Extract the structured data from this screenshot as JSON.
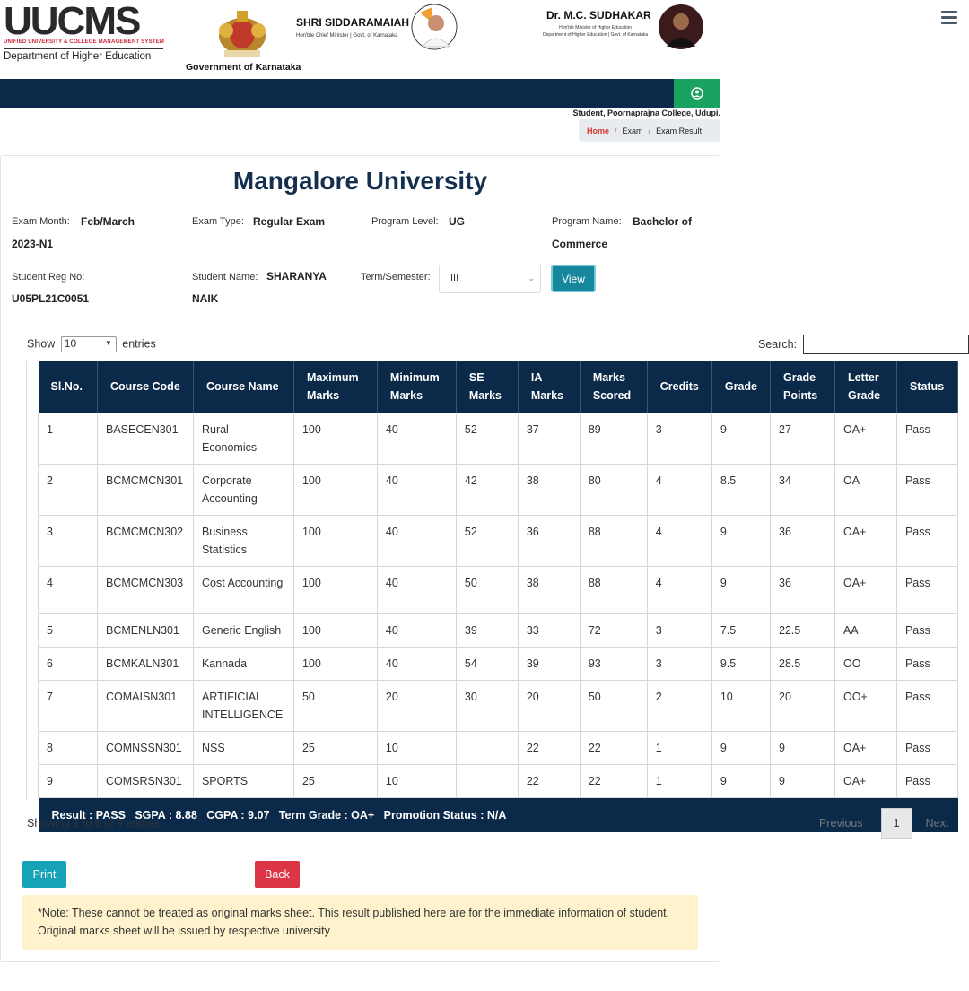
{
  "header": {
    "logo_text": "UUCMS",
    "logo_tagline": "UNIFIED UNIVERSITY & COLLEGE MANAGEMENT SYSTEM",
    "logo_dept": "Department of Higher Education",
    "gov_label": "Government of Karnataka",
    "minister1": {
      "name": "SHRI SIDDARAMAIAH",
      "role": "Hon'ble Chief Minister  |  Govt. of Karnataka"
    },
    "minister2": {
      "name": "Dr. M.C. SUDHAKAR",
      "role_line1": "Hon'ble Minister of Higher Education",
      "role_line2": "Department of Higher Education | Govt. of Karnataka"
    }
  },
  "user_line": "Student, Poornaprajna College, Udupi.",
  "breadcrumb": {
    "home": "Home",
    "items": [
      "Exam",
      "Exam Result"
    ]
  },
  "university": "Mangalore University",
  "fields": {
    "exam_month_label": "Exam Month:",
    "exam_month_value_1": "Feb/March",
    "exam_month_value_2": "2023-N1",
    "exam_type_label": "Exam Type:",
    "exam_type_value": "Regular Exam",
    "program_level_label": "Program Level:",
    "program_level_value": "UG",
    "program_name_label": "Program Name:",
    "program_name_value_1": "Bachelor of",
    "program_name_value_2": "Commerce",
    "reg_no_label": "Student Reg No:",
    "reg_no_value": "U05PL21C0051",
    "student_name_label": "Student Name:",
    "student_name_value_1": "SHARANYA",
    "student_name_value_2": "NAIK",
    "term_label": "Term/Semester:",
    "term_value": "III",
    "view_label": "View"
  },
  "table_controls": {
    "show_label": "Show",
    "show_value": "10",
    "entries_label": "entries",
    "search_label": "Search:"
  },
  "table": {
    "headers": [
      [
        "Sl.No."
      ],
      [
        "Course Code"
      ],
      [
        "Course Name"
      ],
      [
        "Maximum",
        "Marks"
      ],
      [
        "Minimum",
        "Marks"
      ],
      [
        "SE",
        "Marks"
      ],
      [
        "IA",
        "Marks"
      ],
      [
        "Marks",
        "Scored"
      ],
      [
        "Credits"
      ],
      [
        "Grade"
      ],
      [
        "Grade",
        "Points"
      ],
      [
        "Letter",
        "Grade"
      ],
      [
        "Status"
      ]
    ],
    "rows": [
      [
        "1",
        "BASECEN301",
        "Rural Economics",
        "100",
        "40",
        "52",
        "37",
        "89",
        "3",
        "9",
        "27",
        "OA+",
        "Pass"
      ],
      [
        "2",
        "BCMCMCN301",
        "Corporate Accounting",
        "100",
        "40",
        "42",
        "38",
        "80",
        "4",
        "8.5",
        "34",
        "OA",
        "Pass"
      ],
      [
        "3",
        "BCMCMCN302",
        "Business Statistics",
        "100",
        "40",
        "52",
        "36",
        "88",
        "4",
        "9",
        "36",
        "OA+",
        "Pass"
      ],
      [
        "4",
        "BCMCMCN303",
        "Cost Accounting",
        "100",
        "40",
        "50",
        "38",
        "88",
        "4",
        "9",
        "36",
        "OA+",
        "Pass"
      ],
      [
        "5",
        "BCMENLN301",
        "Generic English",
        "100",
        "40",
        "39",
        "33",
        "72",
        "3",
        "7.5",
        "22.5",
        "AA",
        "Pass"
      ],
      [
        "6",
        "BCMKALN301",
        "Kannada",
        "100",
        "40",
        "54",
        "39",
        "93",
        "3",
        "9.5",
        "28.5",
        "OO",
        "Pass"
      ],
      [
        "7",
        "COMAISN301",
        "ARTIFICIAL INTELLIGENCE",
        "50",
        "20",
        "30",
        "20",
        "50",
        "2",
        "10",
        "20",
        "OO+",
        "Pass"
      ],
      [
        "8",
        "COMNSSN301",
        "NSS",
        "25",
        "10",
        "",
        "22",
        "22",
        "1",
        "9",
        "9",
        "OA+",
        "Pass"
      ],
      [
        "9",
        "COMSRSN301",
        "SPORTS",
        "25",
        "10",
        "",
        "22",
        "22",
        "1",
        "9",
        "9",
        "OA+",
        "Pass"
      ]
    ],
    "result_line": "Result : PASS   SGPA : 8.88   CGPA : 9.07   Term Grade : OA+   Promotion Status : N/A"
  },
  "footer": {
    "showing": "Showing 1 to 9 of 9 entries",
    "previous": "Previous",
    "page": "1",
    "next": "Next",
    "print": "Print",
    "back": "Back",
    "note": "*Note: These cannot be treated as original marks sheet. This result published here are for the immediate information of student. Original marks sheet will be issued by respective university"
  },
  "colors": {
    "navy": "#0b2a4a",
    "green": "#1aa260",
    "teal": "#17879e",
    "red": "#dc3545",
    "note_bg": "#fff3cd"
  },
  "icons": [
    "menu-icon",
    "user-circle-icon",
    "chevron-down-icon",
    "state-emblem-icon"
  ]
}
